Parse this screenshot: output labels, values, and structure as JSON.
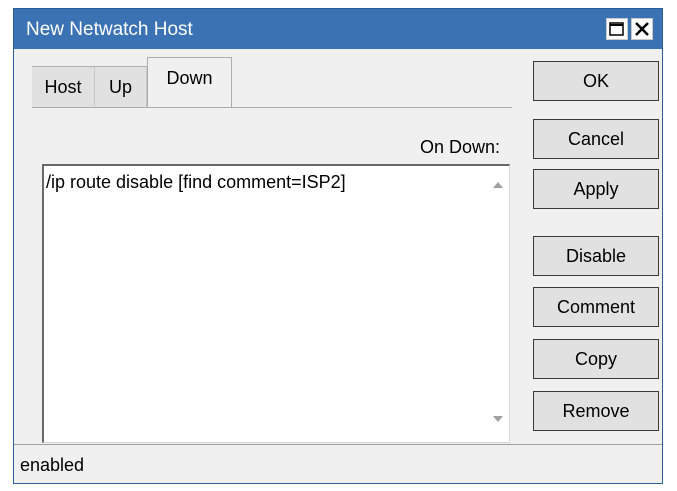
{
  "window": {
    "title": "New Netwatch Host"
  },
  "tabs": [
    {
      "label": "Host"
    },
    {
      "label": "Up"
    },
    {
      "label": "Down"
    }
  ],
  "on_down": {
    "label": "On Down:",
    "script": "/ip route disable [find comment=ISP2]"
  },
  "buttons": {
    "ok": "OK",
    "cancel": "Cancel",
    "apply": "Apply",
    "disable": "Disable",
    "comment": "Comment",
    "copy": "Copy",
    "remove": "Remove"
  },
  "status": {
    "text": "enabled"
  },
  "icons": {
    "maximize": "maximize-icon",
    "close": "close-icon",
    "scroll_up": "scroll-up-arrow-icon",
    "scroll_down": "scroll-down-arrow-icon"
  },
  "colors": {
    "titlebar": "#3a72b4",
    "window_bg": "#f0f0f0"
  }
}
